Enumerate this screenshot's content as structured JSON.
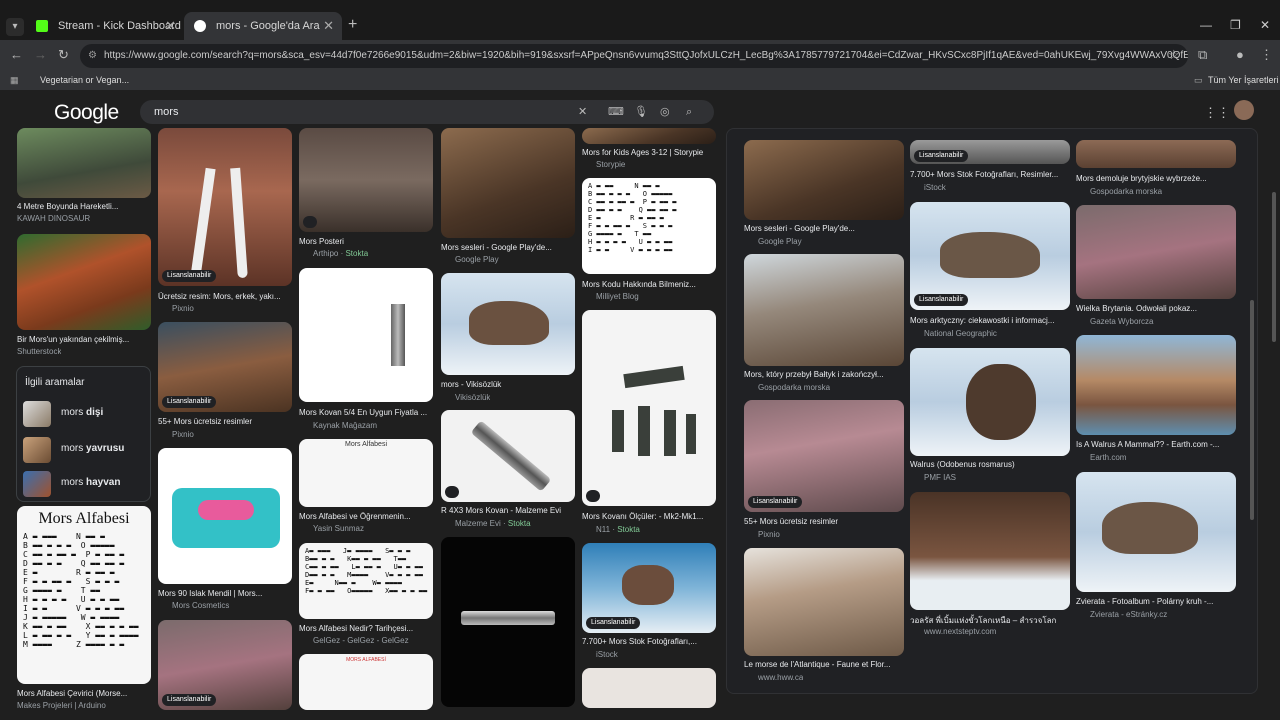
{
  "browser": {
    "tabs": [
      {
        "label": "Stream - Kick Dashboard",
        "favicon_color": "#53fc18"
      },
      {
        "label": "mors - Google'da Ara",
        "favicon_color": "#4285f4"
      }
    ],
    "url": "https://www.google.com/search?q=mors&sca_esv=44d7f0e7266e9015&udm=2&biw=1920&bih=919&sxsrf=APpeQnsn6vvumq3SttQJofxULCzH_LecBg%3A1785779721704&ei=CdZwar_HKvSCxc8PjIf1qAE&ved=0ahUKEwj_79Xvg4WWAxV0QfEDHYxD...",
    "bookmark": "Vegetarian or Vegan...",
    "bookmarks_all": "Tüm Yer İşaretleri"
  },
  "google": {
    "logo": "Google",
    "query": "mors"
  },
  "grid": {
    "col1": [
      {
        "caption": "4 Metre Boyunda Hareketli...",
        "source": "KAWAH DINOSAUR"
      },
      {
        "caption": "Bir Mors'un yakından çekilmiş...",
        "source": "Shutterstock"
      },
      {
        "caption": "Mors Alfabesi Çevirici (Morse...",
        "source": "Makes Projeleri | Arduino",
        "doc_title": "Mors Alfabesi"
      }
    ],
    "col2": [
      {
        "caption": "Ücretsiz resim: Mors, erkek, yakı...",
        "source": "Pixnio",
        "badge": "Lisanslanabilir"
      },
      {
        "caption": "55+ Mors ücretsiz resimler",
        "source": "Pixnio",
        "badge": "Lisanslanabilir"
      },
      {
        "caption": "Mors 90 Islak Mendil | Mors...",
        "source": "Mors Cosmetics"
      },
      {
        "badge": "Lisanslanabilir"
      }
    ],
    "col3": [
      {
        "caption": "Mors Posteri",
        "source": "Arthipo",
        "stock": "Stokta"
      },
      {
        "caption": "Mors Kovan 5/4 En Uygun Fiyatla ...",
        "source": "Kaynak Mağazam"
      },
      {
        "caption": "Mors Alfabesi ve Öğrenmenin...",
        "source": "Yasin Sunmaz",
        "doc_title": "Mors Alfabesi"
      },
      {
        "caption": "Mors Alfabesi Nedir? Tarihçesi...",
        "source": "GelGez - GelGez - GelGez"
      },
      {
        "doc_title": "MORS ALFABESİ"
      }
    ],
    "col4": [
      {
        "caption": "Mors sesleri - Google Play'de...",
        "source": "Google Play"
      },
      {
        "caption": "mors - Vikisözlük",
        "source": "Vikisözlük"
      },
      {
        "caption": "R 4X3 Mors Kovan - Malzeme Evi",
        "source": "Malzeme Evi",
        "stock": "Stokta"
      }
    ],
    "col5": [
      {
        "caption": "Mors for Kids Ages 3-12 | Storypie",
        "source": "Storypie"
      },
      {
        "caption": "Mors Kodu Hakkında Bilmeniz...",
        "source": "Milliyet Blog"
      },
      {
        "caption": "Mors Kovanı Ölçüler: - Mk2-Mk1...",
        "source": "N11",
        "stock": "Stokta"
      },
      {
        "caption": "7.700+ Mors Stok Fotoğrafları,...",
        "source": "iStock",
        "badge": "Lisanslanabilir"
      }
    ]
  },
  "related": {
    "heading": "İlgili aramalar",
    "items": [
      {
        "base": "mors",
        "bold": "dişi"
      },
      {
        "base": "mors",
        "bold": "yavrusu"
      },
      {
        "base": "mors",
        "bold": "hayvan"
      }
    ]
  },
  "panel": {
    "col1": [
      {
        "caption": "Mors sesleri - Google Play'de...",
        "source": "Google Play"
      },
      {
        "caption": "Mors, który przebył Bałtyk i zakończył...",
        "source": "Gospodarka morska"
      },
      {
        "caption": "55+ Mors ücretsiz resimler",
        "source": "Pixnio",
        "badge": "Lisanslanabilir"
      },
      {
        "caption": "Le morse de l'Atlantique - Faune et Flor...",
        "source": "www.hww.ca"
      }
    ],
    "col2": [
      {
        "caption": "7.700+ Mors Stok Fotoğrafları, Resimler...",
        "source": "iStock",
        "badge": "Lisanslanabilir"
      },
      {
        "caption": "Mors arktyczny: ciekawostki i informacj...",
        "source": "National Geographic",
        "badge": "Lisanslanabilir"
      },
      {
        "caption": "Walrus (Odobenus rosmarus)",
        "source": "PMF IAS"
      },
      {
        "caption": "วอลรัส พี่เบิ้มแห่งขั้วโลกเหนือ – สำรวจโลก",
        "source": "www.nextsteptv.com"
      }
    ],
    "col3": [
      {
        "caption": "Mors demoluje brytyjskie wybrzeże...",
        "source": "Gospodarka morska"
      },
      {
        "caption": "Wielka Brytania. Odwołali pokaz...",
        "source": "Gazeta Wyborcza"
      },
      {
        "caption": "Is A Walrus A Mammal?? - Earth.com -...",
        "source": "Earth.com"
      },
      {
        "caption": "Zvierata - Fotoalbum - Polárny kruh -...",
        "source": "Zvierata - eStránky.cz"
      }
    ]
  }
}
